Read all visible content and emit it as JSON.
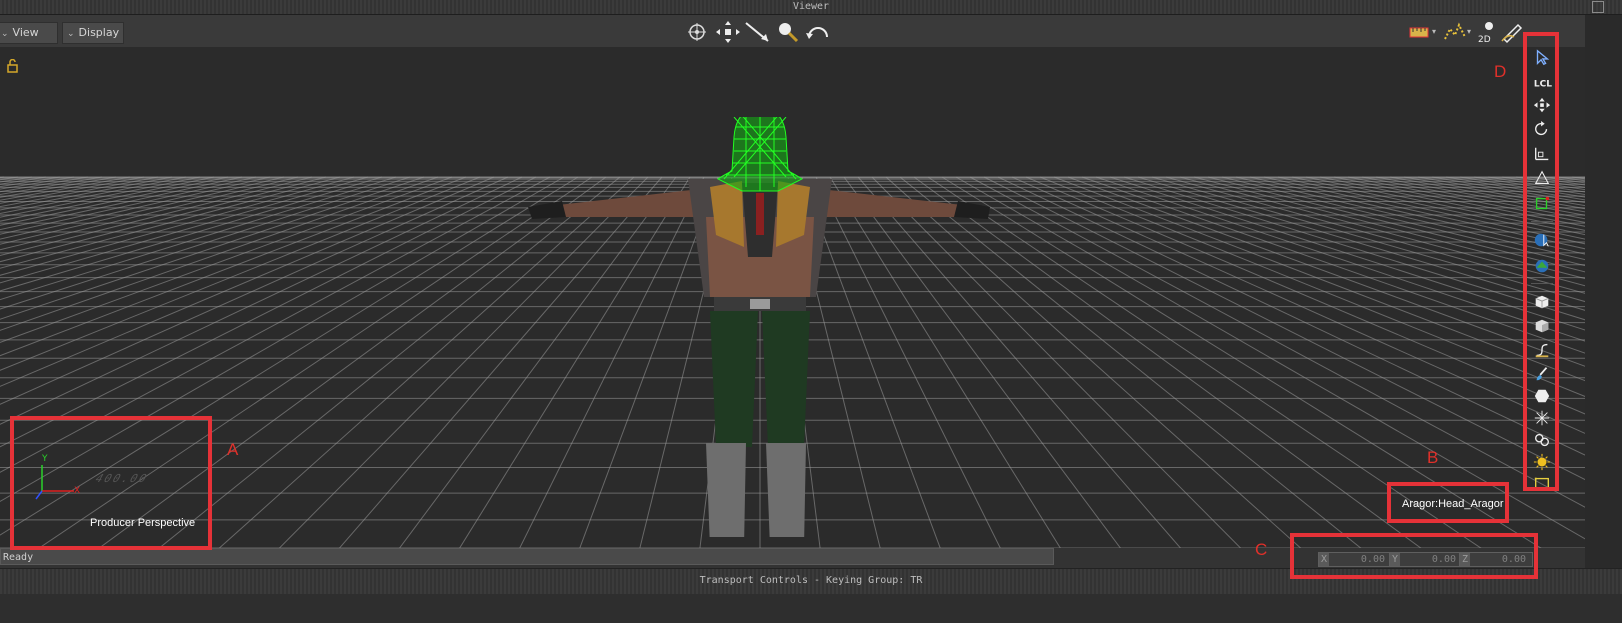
{
  "window": {
    "title": "Viewer"
  },
  "toolbar": {
    "view_label": "View",
    "display_label": "Display",
    "nav_icons": [
      "orbit-icon",
      "pan-icon",
      "dolly-icon",
      "zoom-icon",
      "undo-camera-icon"
    ],
    "right_icons": [
      "ruler-icon",
      "path-icon",
      "2d-view-icon",
      "pencil-icon"
    ],
    "right_icons_label": "2D"
  },
  "viewport": {
    "camera_name": "Producer Perspective",
    "selected_object": "Aragor:Head_Aragor",
    "axis_labels": {
      "y": "Y",
      "x": "X"
    },
    "grid_text": "400.00"
  },
  "status": {
    "text": "Ready"
  },
  "coords": {
    "x": {
      "axis": "X",
      "value": "0.00"
    },
    "y": {
      "axis": "Y",
      "value": "0.00"
    },
    "z": {
      "axis": "Z",
      "value": "0.00"
    }
  },
  "transport": {
    "text": "Transport Controls  -  Keying Group: TR"
  },
  "annotations": {
    "a": "A",
    "b": "B",
    "c": "C",
    "d": "D"
  },
  "right_toolbar": {
    "items": [
      "select-icon",
      "local-icon",
      "translate-icon",
      "rotate-icon",
      "scale-icon",
      "pivot-icon",
      "constraint-icon",
      "globe-select-icon",
      "globe-icon",
      "cube-icon",
      "cube-solid-icon",
      "curve-icon",
      "brush-icon",
      "hexagon-icon",
      "particle-icon",
      "link-icon",
      "light-icon",
      "frame-icon"
    ],
    "local_label": "Lcl"
  },
  "colors": {
    "accent": "#e53238",
    "wireframe": "#22ff22",
    "grid": "#9a9a9a"
  }
}
